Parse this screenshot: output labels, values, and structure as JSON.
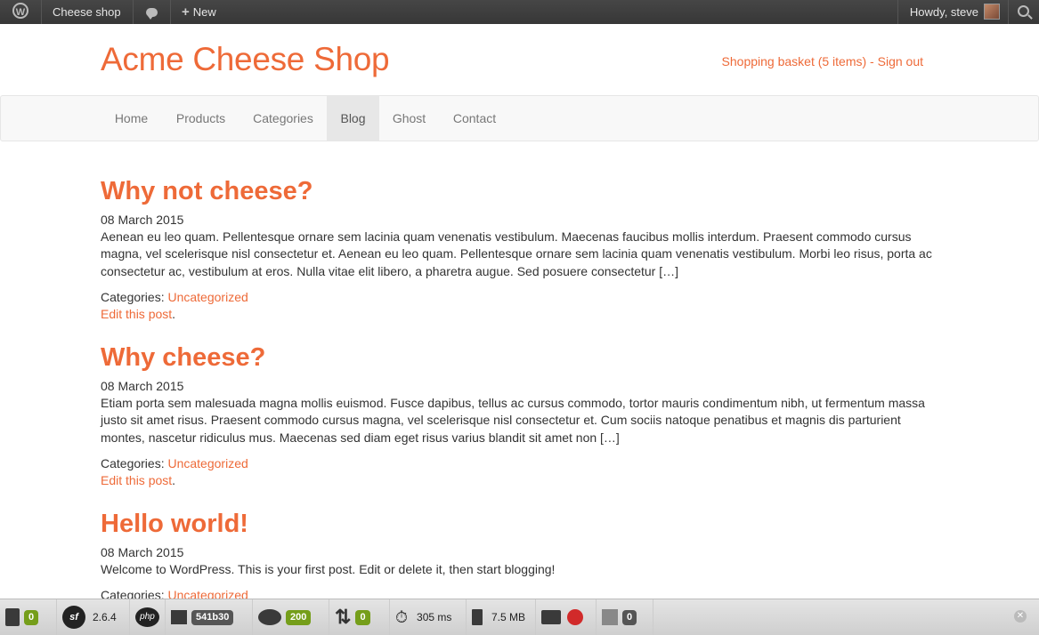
{
  "adminbar": {
    "site_name": "Cheese shop",
    "new_label": "New",
    "howdy": "Howdy, steve"
  },
  "header": {
    "site_title": "Acme Cheese Shop",
    "basket_link": "Shopping basket (5 items)",
    "separator": " - ",
    "signout_link": "Sign out"
  },
  "nav": {
    "items": [
      {
        "label": "Home"
      },
      {
        "label": "Products"
      },
      {
        "label": "Categories"
      },
      {
        "label": "Blog"
      },
      {
        "label": "Ghost"
      },
      {
        "label": "Contact"
      }
    ],
    "active": "Blog"
  },
  "posts": [
    {
      "title": "Why not cheese?",
      "date": "08 March 2015",
      "excerpt": "Aenean eu leo quam. Pellentesque ornare sem lacinia quam venenatis vestibulum. Maecenas faucibus mollis interdum. Praesent commodo cursus magna, vel scelerisque nisl consectetur et. Aenean eu leo quam. Pellentesque ornare sem lacinia quam venenatis vestibulum. Morbi leo risus, porta ac consectetur ac, vestibulum at eros. Nulla vitae elit libero, a pharetra augue. Sed posuere consectetur […]",
      "categories_label": "Categories: ",
      "category": "Uncategorized",
      "edit_label": "Edit this post",
      "edit_suffix": "."
    },
    {
      "title": "Why cheese?",
      "date": "08 March 2015",
      "excerpt": "Etiam porta sem malesuada magna mollis euismod. Fusce dapibus, tellus ac cursus commodo, tortor mauris condimentum nibh, ut fermentum massa justo sit amet risus. Praesent commodo cursus magna, vel scelerisque nisl consectetur et. Cum sociis natoque penatibus et magnis dis parturient montes, nascetur ridiculus mus. Maecenas sed diam eget risus varius blandit sit amet non […]",
      "categories_label": "Categories: ",
      "category": "Uncategorized",
      "edit_label": "Edit this post",
      "edit_suffix": "."
    },
    {
      "title": "Hello world!",
      "date": "08 March 2015",
      "excerpt": "Welcome to WordPress. This is your first post. Edit or delete it, then start blogging!",
      "categories_label": "Categories: ",
      "category": "Uncategorized"
    }
  ],
  "toolbar": {
    "requests_count": "0",
    "symfony_version": "2.6.4",
    "token": "541b30",
    "status_code": "200",
    "redirects_count": "0",
    "time": "305 ms",
    "memory": "7.5 MB",
    "queries_count": "0"
  },
  "colors": {
    "accent": "#ee6a38",
    "adminbar": "#3c3c3c",
    "badge_green": "#759e1a"
  }
}
